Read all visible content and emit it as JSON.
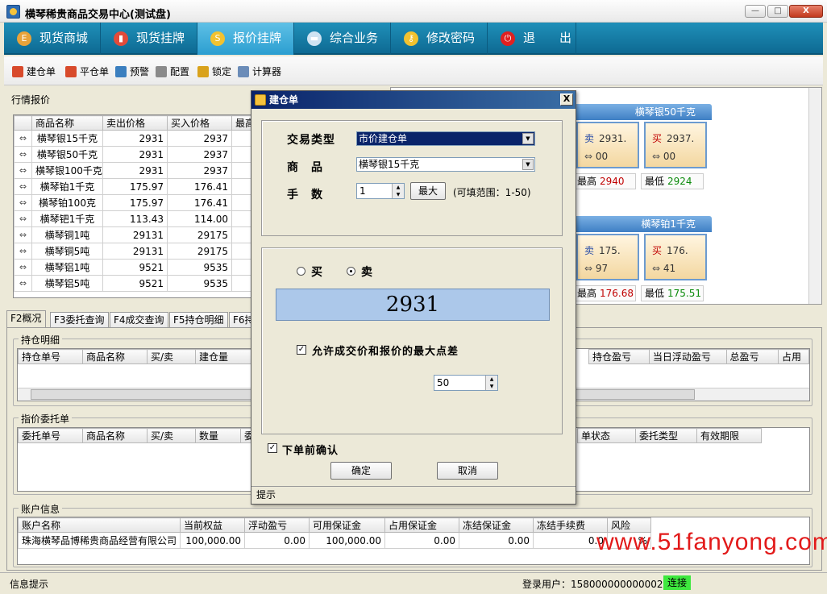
{
  "window": {
    "title": "横琴稀贵商品交易中心(测试盘)",
    "min": "—",
    "max": "□",
    "close": "X"
  },
  "nav": [
    {
      "label": "现货商城",
      "icon": "coin-icon",
      "glyph": "E",
      "color": "#e9a33a"
    },
    {
      "label": "现货挂牌",
      "icon": "bar-chart-icon",
      "glyph": "▮",
      "color": "#e34b3a"
    },
    {
      "label": "报价挂牌",
      "icon": "dollar-icon",
      "glyph": "S",
      "color": "#f2c230",
      "active": true
    },
    {
      "label": "综合业务",
      "icon": "monitor-icon",
      "glyph": "▬",
      "color": "#cfe3f2"
    },
    {
      "label": "修改密码",
      "icon": "key-icon",
      "glyph": "⚷",
      "color": "#f2c230"
    },
    {
      "label": "退　　出",
      "icon": "power-icon",
      "glyph": "⏻",
      "color": "#e02020"
    }
  ],
  "toolbar": [
    {
      "label": "建仓单",
      "icon": "open-position-icon",
      "color": "#d84a2b"
    },
    {
      "label": "平仓单",
      "icon": "close-position-icon",
      "color": "#d84a2b"
    },
    {
      "label": "预警",
      "icon": "alert-icon",
      "color": "#3b7fbf"
    },
    {
      "label": "配置",
      "icon": "config-icon",
      "color": "#8a8a8a"
    },
    {
      "label": "锁定",
      "icon": "lock-icon",
      "color": "#d9a21c"
    },
    {
      "label": "计算器",
      "icon": "calculator-icon",
      "color": "#6b8cb8"
    }
  ],
  "quotes": {
    "title": "行情报价",
    "columns": [
      "商品名称",
      "卖出价格",
      "买入价格",
      "最高"
    ],
    "rows": [
      [
        "横琴银15千克",
        "2931",
        "2937"
      ],
      [
        "横琴银50千克",
        "2931",
        "2937"
      ],
      [
        "横琴银100千克",
        "2931",
        "2937"
      ],
      [
        "横琴铂1千克",
        "175.97",
        "176.41"
      ],
      [
        "横琴铂100克",
        "175.97",
        "176.41"
      ],
      [
        "横琴钯1千克",
        "113.43",
        "114.00"
      ],
      [
        "横琴铜1吨",
        "29131",
        "29175"
      ],
      [
        "横琴铜5吨",
        "29131",
        "29175"
      ],
      [
        "横琴铝1吨",
        "9521",
        "9535"
      ],
      [
        "横琴铝5吨",
        "9521",
        "9535"
      ]
    ]
  },
  "cards": [
    {
      "title": "横琴银50千克",
      "sell_label": "卖",
      "sell_a": "2931.",
      "sell_b": "00",
      "buy_label": "买",
      "buy_a": "2937.",
      "buy_b": "00",
      "high_label": "最高",
      "high": "2940",
      "low_label": "最低",
      "low": "2924"
    },
    {
      "title": "横琴铂1千克",
      "sell_label": "卖",
      "sell_a": "175.",
      "sell_b": "97",
      "buy_label": "买",
      "buy_a": "176.",
      "buy_b": "41",
      "high_label": "最高",
      "high": "176.68",
      "low_label": "最低",
      "low": "175.51"
    }
  ],
  "tabs": [
    "F2概况",
    "F3委托查询",
    "F4成交查询",
    "F5持仓明细",
    "F6持"
  ],
  "holdings": {
    "title": "持仓明细",
    "columns_left": [
      "持仓单号",
      "商品名称",
      "买/卖",
      "建仓量"
    ],
    "columns_right": [
      "持仓盈亏",
      "当日浮动盈亏",
      "总盈亏",
      "占用"
    ]
  },
  "orders": {
    "title": "指价委托单",
    "columns_left": [
      "委托单号",
      "商品名称",
      "买/卖",
      "数量",
      "委"
    ],
    "columns_right": [
      "单状态",
      "委托类型",
      "有效期限"
    ]
  },
  "account": {
    "title": "账户信息",
    "columns": [
      "账户名称",
      "当前权益",
      "浮动盈亏",
      "可用保证金",
      "占用保证金",
      "冻结保证金",
      "冻结手续费",
      "风险"
    ],
    "row": [
      "珠海横琴品博稀贵商品经营有限公司",
      "100,000.00",
      "0.00",
      "100,000.00",
      "0.00",
      "0.00",
      "0.0",
      "%"
    ]
  },
  "status": {
    "left": "信息提示",
    "user": "登录用户：158000000000002",
    "connection": "连接",
    "connection_color": "#3ee83e"
  },
  "dialog": {
    "title": "建仓单",
    "close": "X",
    "trade_type_label": "交易类型",
    "trade_type": "市价建仓单",
    "product_label": "商　品",
    "product": "横琴银15千克",
    "quantity_label": "手　数",
    "quantity": "1",
    "max_button": "最大",
    "range_hint": "(可填范围：1-50)",
    "buy_label": "买",
    "sell_label": "卖",
    "price": "2931",
    "allow_diff_label": "允许成交价和报价的最大点差",
    "diff_value": "50",
    "confirm_label": "下单前确认",
    "ok": "确定",
    "cancel": "取消",
    "hint": "提示"
  },
  "watermark": "www.51fanyong.com"
}
